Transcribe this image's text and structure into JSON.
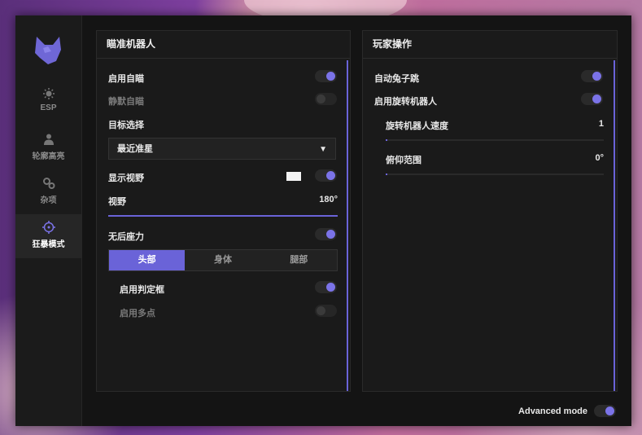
{
  "sidebar": {
    "items": [
      {
        "label": "ESP",
        "icon": "sun-icon"
      },
      {
        "label": "轮廓高亮",
        "icon": "person-icon"
      },
      {
        "label": "杂项",
        "icon": "gears-icon"
      },
      {
        "label": "狂暴模式",
        "icon": "crosshair-icon",
        "active": true
      }
    ]
  },
  "left_panel": {
    "title": "瞄准机器人",
    "enable_aimbot": {
      "label": "启用自瞄",
      "on": true
    },
    "silent_aim": {
      "label": "静默自瞄",
      "on": false
    },
    "target_select": {
      "label": "目标选择",
      "value": "最近准星"
    },
    "show_fov": {
      "label": "显示视野",
      "on": true
    },
    "fov": {
      "label": "视野",
      "value": "180°",
      "fraction": 1.0
    },
    "no_recoil": {
      "label": "无后座力",
      "on": true
    },
    "hitbox_tabs": [
      "头部",
      "身体",
      "腿部"
    ],
    "hitbox_active": 0,
    "enable_hitbox": {
      "label": "启用判定框",
      "on": true
    },
    "multipoint": {
      "label": "启用多点",
      "on": false
    }
  },
  "right_panel": {
    "title": "玩家操作",
    "auto_bhop": {
      "label": "自动兔子跳",
      "on": true
    },
    "spinbot": {
      "label": "启用旋转机器人",
      "on": true
    },
    "spin_speed": {
      "label": "旋转机器人速度",
      "value": "1",
      "fraction": 0.0
    },
    "pitch_range": {
      "label": "俯仰范围",
      "value": "0°",
      "fraction": 0.0
    }
  },
  "footer": {
    "advanced_mode": {
      "label": "Advanced mode",
      "on": true
    }
  },
  "colors": {
    "accent": "#6a63d8",
    "background": "#141414",
    "panel": "#1a1a1a"
  }
}
